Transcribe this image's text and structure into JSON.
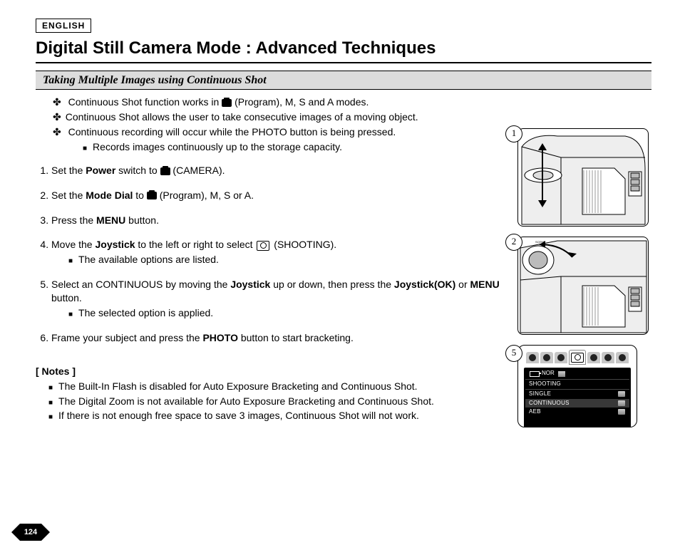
{
  "language_badge": "ENGLISH",
  "page_title": "Digital Still Camera Mode : Advanced Techniques",
  "subtitle": "Taking Multiple Images using Continuous Shot",
  "intro": {
    "i1a": "Continuous Shot  function works in ",
    "i1b": " (Program), M, S and A modes.",
    "i2": "Continuous Shot allows the user to take consecutive images of a moving object.",
    "i3": "Continuous recording will occur while the PHOTO button is being pressed.",
    "i3a": "Records images continuously up to the storage capacity."
  },
  "steps": {
    "s1a": "Set the ",
    "s1b": "Power",
    "s1c": " switch to ",
    "s1d": " (CAMERA).",
    "s2a": "Set the ",
    "s2b": "Mode Dial",
    "s2c": " to ",
    "s2d": " (Program), M, S or A.",
    "s3a": "Press the ",
    "s3b": "MENU",
    "s3c": " button.",
    "s4a": "Move the ",
    "s4b": "Joystick",
    "s4c": " to the left or right to select  ",
    "s4d": " (SHOOTING).",
    "s4sub": "The available options are listed.",
    "s5a": "Select an CONTINUOUS by moving the ",
    "s5b": "Joystick",
    "s5c": " up or down, then press the ",
    "s5d": "Joystick(OK)",
    "s5e": " or ",
    "s5f": "MENU",
    "s5g": " button.",
    "s5sub": "The selected option is applied.",
    "s6a": "Frame your subject and press the ",
    "s6b": "PHOTO",
    "s6c": " button to start bracketing."
  },
  "notes_header": "[ Notes ]",
  "notes": {
    "n1": "The Built-In Flash is disabled for Auto Exposure Bracketing and Continuous Shot.",
    "n2": "The Digital Zoom is not available for Auto Exposure Bracketing and Continuous Shot.",
    "n3": "If there is not enough free space to save 3 images, Continuous Shot will not work."
  },
  "figure_badges": {
    "f1": "1",
    "f2": "2",
    "f5": "5"
  },
  "lcd": {
    "nor": "NOR",
    "section": "SHOOTING",
    "opt_single": "SINGLE",
    "opt_continuous": "CONTINUOUS",
    "opt_aeb": "AEB"
  },
  "page_number": "124"
}
